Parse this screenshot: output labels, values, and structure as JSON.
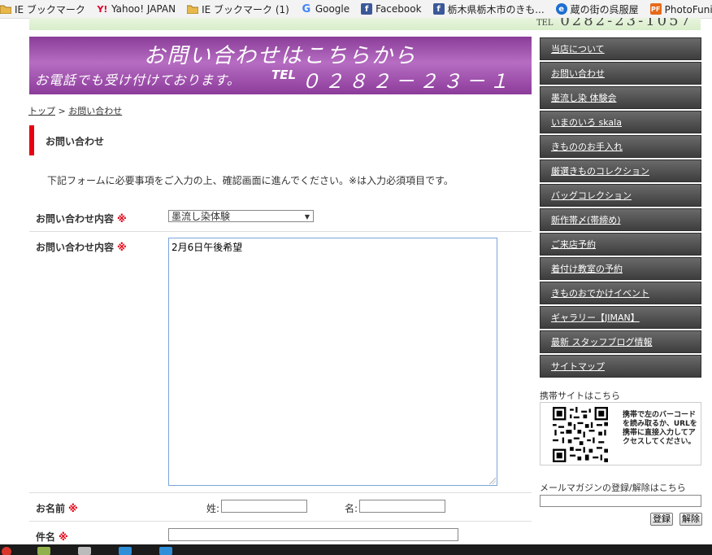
{
  "bookmarks": [
    {
      "label": "IE ブックマーク",
      "icon": "folder-icon"
    },
    {
      "label": "Yahoo! JAPAN",
      "icon": "yahoo-icon"
    },
    {
      "label": "IE ブックマーク (1)",
      "icon": "folder-icon"
    },
    {
      "label": "Google",
      "icon": "google-icon"
    },
    {
      "label": "Facebook",
      "icon": "facebook-icon"
    },
    {
      "label": "栃木県栃木市のきも...",
      "icon": "facebook-icon"
    },
    {
      "label": "蔵の街の呉服屋",
      "icon": "ie-icon"
    },
    {
      "label": "PhotoFunia :: 似顔絵",
      "icon": "photofunia-icon"
    }
  ],
  "header": {
    "phone_top": "0282-23-1057",
    "phone_top_prefix": "TEL",
    "banner_title": "お問い合わせはこちらから",
    "banner_sub": "お電話でも受け付けております。",
    "banner_tel_label": "TEL",
    "banner_tel": "０２８２－２３－１０５７"
  },
  "breadcrumb": {
    "home": "トップ",
    "sep": " > ",
    "current": "お問い合わせ"
  },
  "page": {
    "heading": "お問い合わせ",
    "intro": "下記フォームに必要事項をご入力の上、確認画面に進んでください。※は入力必須項目です。"
  },
  "form": {
    "required_mark": "※",
    "inquiry_type_label": "お問い合わせ内容",
    "inquiry_type_value": "墨流し染体験",
    "inquiry_body_label": "お問い合わせ内容",
    "inquiry_body_value": "2月6日午後希望",
    "name_label": "お名前",
    "last_name_label": "姓:",
    "first_name_label": "名:",
    "last_name_value": "",
    "first_name_value": "",
    "subject_label": "件名",
    "subject_value": ""
  },
  "sidebar": {
    "nav": [
      "当店について",
      "お問い合わせ",
      "墨流し染 体験会",
      "いまのいろ skala",
      "きもののお手入れ",
      "厳選きものコレクション",
      "バッグコレクション",
      "新作帯〆(帯締め)",
      "ご来店予約",
      "着付け教室の予約",
      "きものおでかけイベント",
      "ギャラリー【JIMAN】",
      "最新 スタッフブログ情報",
      "サイトマップ"
    ],
    "mobile_title": "携帯サイトはこちら",
    "mobile_text": "携帯で左のバーコードを読み取るか、URLを携帯に直接入力してアクセスしてください。",
    "mail_title": "メールマガジンの登録/解除はこちら",
    "mail_value": "",
    "register_label": "登録",
    "unregister_label": "解除"
  },
  "colors": {
    "banner": "#9b4aa8",
    "accent_red": "#e60012",
    "nav_bg": "#4a4a4a"
  }
}
